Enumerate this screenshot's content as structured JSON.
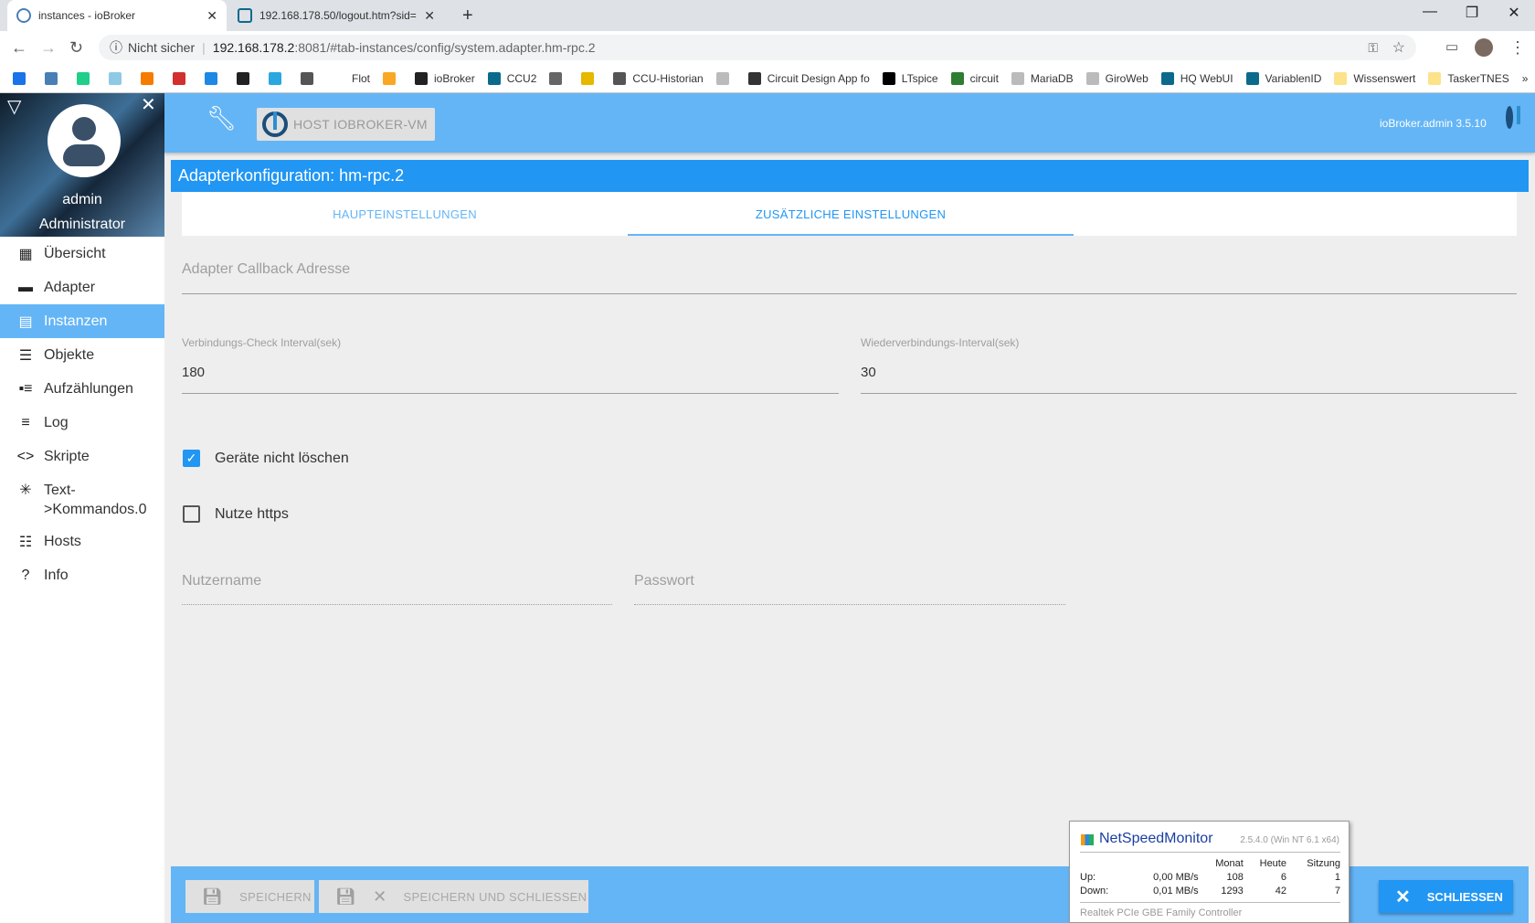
{
  "browser": {
    "tabs": [
      {
        "title": "instances - ioBroker",
        "active": true
      },
      {
        "title": "192.168.178.50/logout.htm?sid=",
        "active": false
      }
    ],
    "new_tab": "+",
    "window_controls": {
      "minimize": "—",
      "restore": "❐",
      "close": "✕"
    },
    "security_label": "Nicht sicher",
    "url_host": "192.168.178.2",
    "url_path": ":8081/#tab-instances/config/system.adapter.hm-rpc.2",
    "bookmarks": [
      {
        "label": "",
        "color": "#1a73e8"
      },
      {
        "label": "",
        "color": "#4a7fb5"
      },
      {
        "label": "",
        "color": "#1fcf8a"
      },
      {
        "label": "",
        "color": "#8ecae6"
      },
      {
        "label": "",
        "color": "#f57c00"
      },
      {
        "label": "",
        "color": "#d32f2f"
      },
      {
        "label": "",
        "color": "#1e88e5"
      },
      {
        "label": "",
        "color": "#222"
      },
      {
        "label": "",
        "color": "#29a7df"
      },
      {
        "label": "",
        "color": "#555"
      },
      {
        "label": "Flot",
        "color": "#fff"
      },
      {
        "label": "",
        "color": "#f9a825"
      },
      {
        "label": "ioBroker",
        "color": "#222"
      },
      {
        "label": "CCU2",
        "color": "#0b6a8c"
      },
      {
        "label": "",
        "color": "#666"
      },
      {
        "label": "",
        "color": "#e6b800"
      },
      {
        "label": "CCU-Historian",
        "color": "#555"
      },
      {
        "label": "",
        "color": "#bbb"
      },
      {
        "label": "Circuit Design App fo",
        "color": "#333"
      },
      {
        "label": "LTspice",
        "color": "#000"
      },
      {
        "label": "circuit",
        "color": "#2e7d32"
      },
      {
        "label": "MariaDB",
        "color": "#bbb"
      },
      {
        "label": "GiroWeb",
        "color": "#bbb"
      },
      {
        "label": "HQ WebUI",
        "color": "#0b6a8c"
      },
      {
        "label": "VariablenID",
        "color": "#0b6a8c"
      },
      {
        "label": "Wissenswert",
        "color": "#fce38a"
      },
      {
        "label": "TaskerTNES",
        "color": "#fce38a"
      }
    ],
    "more": "»"
  },
  "sidebar": {
    "user": "admin",
    "role": "Administrator",
    "items": [
      {
        "label": "Übersicht",
        "icon": "▦",
        "active": false
      },
      {
        "label": "Adapter",
        "icon": "▬",
        "active": false
      },
      {
        "label": "Instanzen",
        "icon": "▤",
        "active": true
      },
      {
        "label": "Objekte",
        "icon": "☰",
        "active": false
      },
      {
        "label": "Aufzählungen",
        "icon": "▪≡",
        "active": false
      },
      {
        "label": "Log",
        "icon": "≡",
        "active": false
      },
      {
        "label": "Skripte",
        "icon": "<>",
        "active": false
      },
      {
        "label": "Text->Kommandos.0",
        "icon": "✳",
        "active": false
      },
      {
        "label": "Hosts",
        "icon": "☷",
        "active": false
      },
      {
        "label": "Info",
        "icon": "?",
        "active": false
      }
    ]
  },
  "appbar": {
    "host_button": "HOST IOBROKER-VM",
    "version": "ioBroker.admin 3.5.10"
  },
  "config": {
    "title": "Adapterkonfiguration: hm-rpc.2",
    "tabs": [
      "HAUPTEINSTELLUNGEN",
      "ZUSÄTZLICHE EINSTELLUNGEN"
    ],
    "active_tab": 1,
    "callback_placeholder": "Adapter Callback Adresse",
    "check_interval": {
      "label": "Verbindungs-Check Interval(sek)",
      "value": "180"
    },
    "reconnect_interval": {
      "label": "Wiederverbindungs-Interval(sek)",
      "value": "30"
    },
    "dont_delete": {
      "label": "Geräte nicht löschen",
      "checked": true
    },
    "use_https": {
      "label": "Nutze https",
      "checked": false
    },
    "username_placeholder": "Nutzername",
    "password_placeholder": "Passwort"
  },
  "footer": {
    "save": "SPEICHERN",
    "save_close": "SPEICHERN UND SCHLIESSEN",
    "close": "SCHLIESSEN"
  },
  "netspeed": {
    "title": "NetSpeedMonitor",
    "version": "2.5.4.0 (Win NT 6.1 x64)",
    "headers": [
      "Monat",
      "Heute",
      "Sitzung"
    ],
    "rows": [
      {
        "label": "Up:",
        "rate": "0,00 MB/s",
        "month": "108",
        "today": "6",
        "session": "1"
      },
      {
        "label": "Down:",
        "rate": "0,01 MB/s",
        "month": "1293",
        "today": "42",
        "session": "7"
      }
    ],
    "adapter": "Realtek PCIe GBE Family Controller"
  },
  "colors": {
    "primary": "#2196f3",
    "appbar": "#64b5f6"
  }
}
